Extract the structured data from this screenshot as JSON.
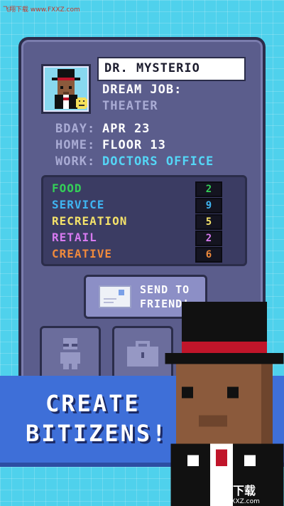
{
  "watermark_top": "飞翔下载 www.FXXZ.com",
  "profile": {
    "name": "DR. MYSTERIO",
    "dream_job_label": "DREAM JOB:",
    "dream_job": "THEATER",
    "bday_label": "BDAY:",
    "bday": "APR 23",
    "home_label": "HOME:",
    "home": "FLOOR 13",
    "work_label": "WORK:",
    "work": "DOCTORS OFFICE"
  },
  "stats": [
    {
      "label": "FOOD",
      "value": "2",
      "color": "#34d058"
    },
    {
      "label": "SERVICE",
      "value": "9",
      "color": "#3fb5f2"
    },
    {
      "label": "RECREATION",
      "value": "5",
      "color": "#f4e26a"
    },
    {
      "label": "RETAIL",
      "value": "2",
      "color": "#d77af0"
    },
    {
      "label": "CREATIVE",
      "value": "6",
      "color": "#f08a3c"
    }
  ],
  "send_button": {
    "line1": "SEND TO",
    "line2": "FRIEND!"
  },
  "banner": {
    "line1": "CREATE",
    "line2": "BITIZENS!"
  },
  "icons": [
    "envelope-icon",
    "person-icon",
    "briefcase-icon",
    "smiley-icon"
  ],
  "watermark_bottom": {
    "text": "飞翔下载",
    "url": "www.FXXZ.com"
  },
  "colors": {
    "background": "#4fd1ec",
    "card": "#5b5d8c",
    "banner": "#3e6fd8"
  }
}
